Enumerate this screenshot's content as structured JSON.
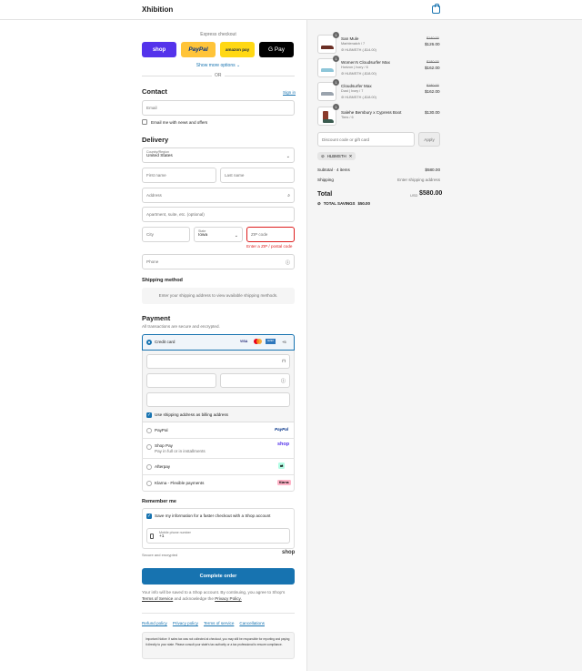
{
  "header": {
    "brand": "Xhibition",
    "cart_icon": "bag-icon"
  },
  "express": {
    "title": "Express checkout",
    "buttons": [
      {
        "label": "shop",
        "color": "#5433eb",
        "text_color": "#ffffff"
      },
      {
        "label": "PayPal",
        "color": "#ffc439",
        "text_color": "#003087"
      },
      {
        "label": "amazon pay",
        "color": "#ffd814",
        "text_color": "#232f3e"
      },
      {
        "label": "G Pay",
        "color": "#000000",
        "text_color": "#ffffff"
      }
    ],
    "more": "Show more options ⌄",
    "or": "OR"
  },
  "contact": {
    "title": "Contact",
    "sign_in": "Sign in",
    "email_placeholder": "Email",
    "news_label": "Email me with news and offers"
  },
  "delivery": {
    "title": "Delivery",
    "country_label": "Country/Region",
    "country_value": "United States",
    "first_name": "First name",
    "last_name": "Last name",
    "address": "Address",
    "apartment": "Apartment, suite, etc. (optional)",
    "city": "City",
    "state_label": "State",
    "state_value": "Iowa",
    "zip": "ZIP code",
    "zip_error": "Enter a ZIP / postal code",
    "phone": "Phone"
  },
  "shipping": {
    "title": "Shipping method",
    "message": "Enter your shipping address to view available shipping methods."
  },
  "payment": {
    "title": "Payment",
    "subtitle": "All transactions are secure and encrypted.",
    "credit_card": "Credit card",
    "card_logos": [
      "VISA",
      "MC",
      "AMEX",
      "+5"
    ],
    "billing_same": "Use shipping address as billing address",
    "methods": [
      {
        "label": "PayPal",
        "sub": "",
        "tag": "PayPal"
      },
      {
        "label": "Shop Pay",
        "sub": "Pay in full or in installments",
        "tag": "shop"
      },
      {
        "label": "Afterpay",
        "sub": "",
        "tag": "⇄"
      },
      {
        "label": "Klarna - Flexible payments",
        "sub": "",
        "tag": "Klarna"
      }
    ]
  },
  "remember": {
    "title": "Remember me",
    "save_label": "Save my information for a faster checkout with a Shop account",
    "phone_label": "Mobile phone number",
    "phone_value": "+1",
    "secure": "Secure and encrypted",
    "shop_logo": "shop"
  },
  "complete_button": "Complete order",
  "terms": {
    "text1": "Your info will be saved to a Shop account. By continuing, you agree to Shop's",
    "tos": "Terms of Service",
    "text2": "and acknowledge the",
    "privacy": "Privacy Policy."
  },
  "footer": {
    "links": [
      "Refund policy",
      "Privacy policy",
      "Terms of service",
      "Cancellations"
    ],
    "notice": "Important Notice: If sales tax was not collected at checkout, you may still be responsible for reporting and paying it directly to your state. Please consult your state's tax authority or a tax professional to ensure compliance."
  },
  "summary": {
    "items": [
      {
        "qty": "1",
        "name": "San Mule",
        "variant": "Marblenatch / 7",
        "discount": "HLBMSTH (-$14.00)",
        "old_price": "$140.00",
        "price": "$126.00"
      },
      {
        "qty": "1",
        "name": "Women's Cloudsurfer Max",
        "variant": "Horizon | Ivory / 6",
        "discount": "HLBMSTH (-$18.00)",
        "old_price": "$180.00",
        "price": "$162.00"
      },
      {
        "qty": "1",
        "name": "Cloudsurfer Max",
        "variant": "Dust | Ivory / 7",
        "discount": "HLBMSTH (-$18.00)",
        "old_price": "$180.00",
        "price": "$162.00"
      },
      {
        "qty": "1",
        "name": "Salehe Bembury x Cypress Boot",
        "variant": "Tiers / 6",
        "discount": "",
        "old_price": "",
        "price": "$130.00"
      }
    ],
    "discount_placeholder": "Discount code or gift card",
    "apply": "Apply",
    "code": "HLBMSTH",
    "subtotal_label": "Subtotal · 4 items",
    "subtotal_value": "$580.00",
    "shipping_label": "Shipping",
    "shipping_value": "Enter shipping address",
    "total_label": "Total",
    "currency": "USD",
    "total_value": "$580.00",
    "savings_label": "TOTAL SAVINGS",
    "savings_value": "$50.00"
  }
}
